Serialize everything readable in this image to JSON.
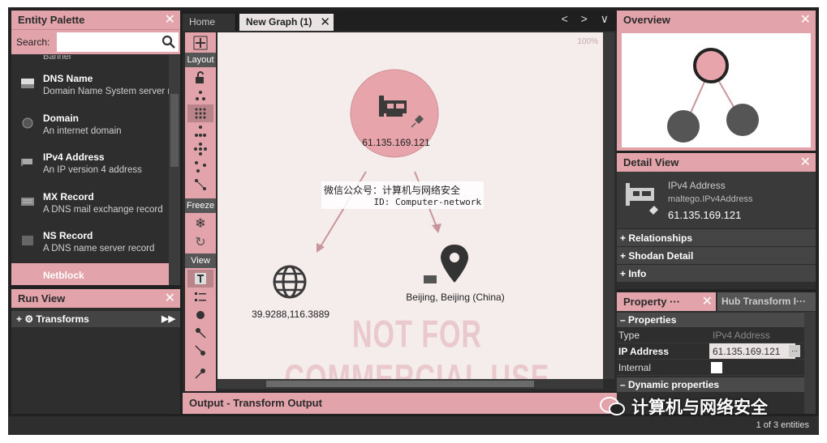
{
  "palette": {
    "title": "Entity Palette",
    "search_label": "Search:",
    "search_value": "",
    "partial_item": "Banner",
    "items": [
      {
        "name": "DNS Name",
        "desc": "Domain Name System server name"
      },
      {
        "name": "Domain",
        "desc": "An internet domain"
      },
      {
        "name": "IPv4 Address",
        "desc": "An IP version 4 address"
      },
      {
        "name": "MX Record",
        "desc": "A DNS mail exchange record"
      },
      {
        "name": "NS Record",
        "desc": "A DNS name server record"
      },
      {
        "name": "Netblock",
        "desc": ""
      }
    ]
  },
  "runview": {
    "title": "Run View",
    "transforms_label": "Transforms"
  },
  "tabs": {
    "home": "Home",
    "active": "New Graph (1)",
    "nav": "< > ∨"
  },
  "toolbar": {
    "layout": "Layout",
    "freeze": "Freeze",
    "view": "View"
  },
  "graph": {
    "zoom": "100%",
    "nodes": {
      "ip": "61.135.169.121",
      "coords": "39.9288,116.3889",
      "location": "Beijing, Beijing (China)"
    },
    "overlay_line1": "微信公众号：计算机与网络安全",
    "overlay_line2": "ID: Computer-network",
    "watermark": "NOT FOR COMMERCIAL USE"
  },
  "output": {
    "title": "Output - Transform Output"
  },
  "status": {
    "count": "1 of 3 entities"
  },
  "overview": {
    "title": "Overview"
  },
  "detail": {
    "title": "Detail View",
    "type": "IPv4 Address",
    "type_id": "maltego.IPv4Address",
    "value": "61.135.169.121",
    "sections": [
      "+ Relationships",
      "+ Shodan Detail",
      "+ Info"
    ]
  },
  "property": {
    "tab1": "Property ···",
    "tab2": "Hub Transform I···",
    "section1": "– Properties",
    "rows": [
      {
        "key": "Type",
        "value": "IPv4 Address"
      },
      {
        "key": "IP Address",
        "value": "61.135.169.121"
      },
      {
        "key": "Internal",
        "value": ""
      }
    ],
    "section2": "– Dynamic properties",
    "btn": "..."
  },
  "wechat_watermark": "计算机与网络安全",
  "colors": {
    "accent": "#e2a3aa",
    "panel": "#2e2e2e"
  }
}
